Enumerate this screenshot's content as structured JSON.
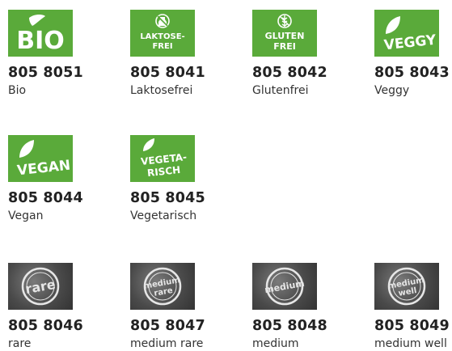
{
  "products": [
    {
      "code": "805 8051",
      "name": "Bio",
      "badge_text": "BIO",
      "icon": "bio-leaf-icon"
    },
    {
      "code": "805 8041",
      "name": "Laktosefrei",
      "badge_text": "LAKTOSE-FREI",
      "icon": "lactose-free-icon"
    },
    {
      "code": "805 8042",
      "name": "Glutenfrei",
      "badge_text": "GLUTEN FREI",
      "icon": "gluten-free-icon"
    },
    {
      "code": "805 8043",
      "name": "Veggy",
      "badge_text": "VEGGY",
      "icon": "leaf-icon"
    },
    {
      "code": "805 8044",
      "name": "Vegan",
      "badge_text": "VEGAN",
      "icon": "leaf-icon"
    },
    {
      "code": "805 8045",
      "name": "Vegetarisch",
      "badge_text": "VEGETA-RISCH",
      "icon": "leaf-icon"
    },
    {
      "code": "805 8046",
      "name": "rare",
      "badge_text": "rare",
      "icon": "stamp-icon"
    },
    {
      "code": "805 8047",
      "name": "medium rare",
      "badge_text": "medium rare",
      "icon": "stamp-icon"
    },
    {
      "code": "805 8048",
      "name": "medium",
      "badge_text": "medium",
      "icon": "stamp-icon"
    },
    {
      "code": "805 8049",
      "name": "medium well",
      "badge_text": "medium well",
      "icon": "stamp-icon"
    }
  ],
  "colors": {
    "badge_green": "#5aaa3a",
    "badge_dark": "#4a4a4a",
    "text": "#222222"
  }
}
